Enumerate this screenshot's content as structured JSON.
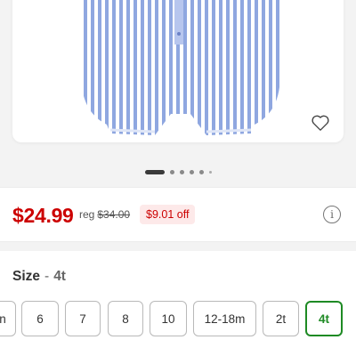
{
  "product": {
    "price": "$24.99",
    "reg_label": "reg",
    "reg_price": "$34.00",
    "savings": "$9.01 off"
  },
  "carousel": {
    "total_dots": 6,
    "active_index": 0
  },
  "size": {
    "label": "Size",
    "separator": "-",
    "selected": "4t",
    "options": [
      "n",
      "6",
      "7",
      "8",
      "10",
      "12-18m",
      "2t",
      "4t"
    ]
  },
  "icons": {
    "favorite": "heart-icon",
    "info": "info-icon"
  },
  "colors": {
    "price_red": "#cc0000",
    "savings_bg": "#fde9e9",
    "selected_green": "#1e8a24"
  }
}
